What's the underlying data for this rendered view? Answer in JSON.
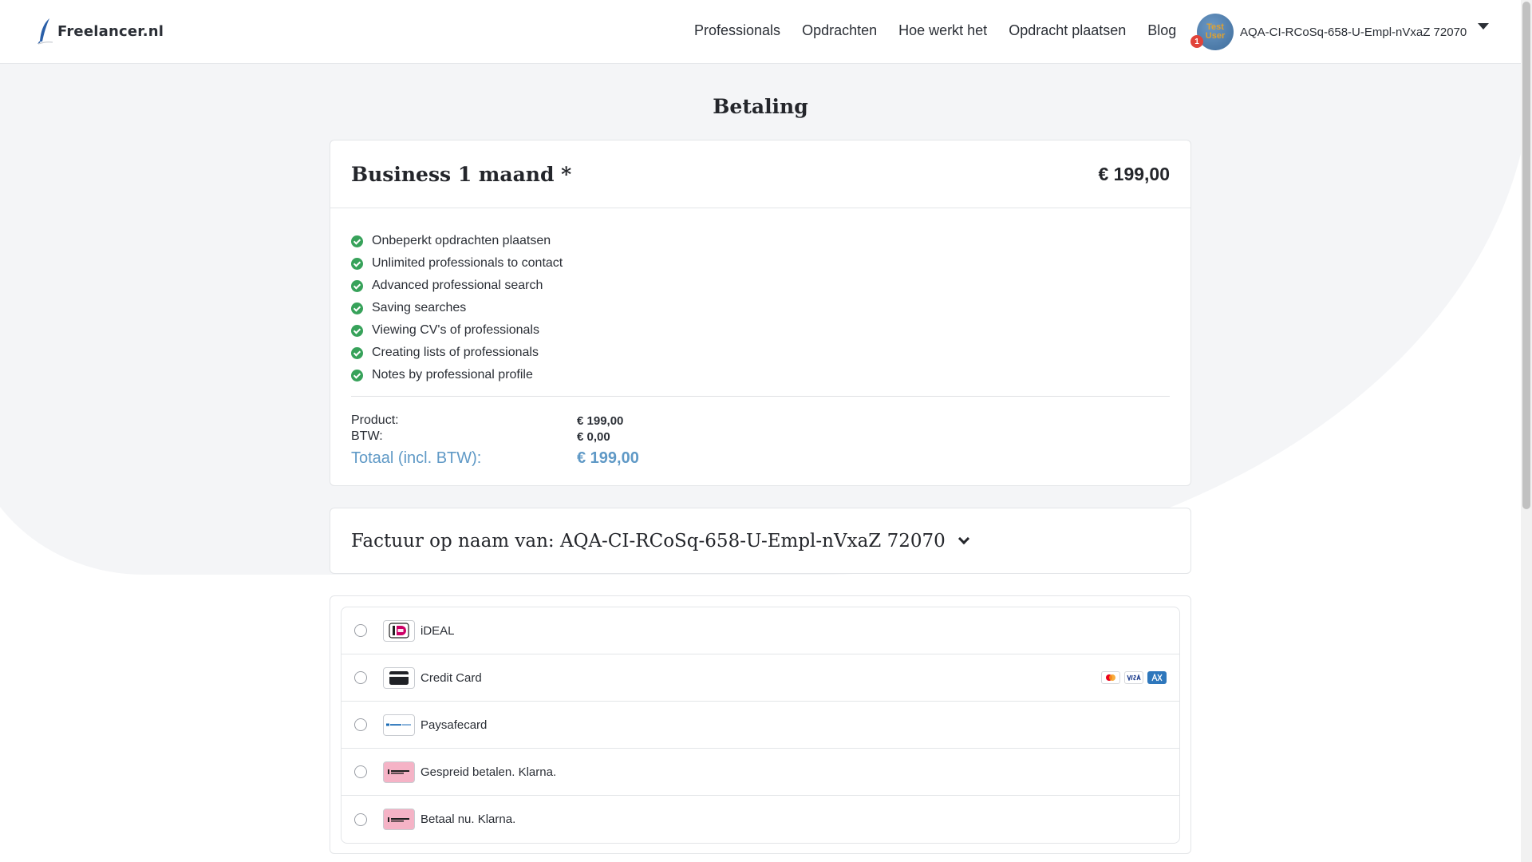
{
  "header": {
    "logo_text": "Freelancer.nl",
    "nav": [
      "Professionals",
      "Opdrachten",
      "Hoe werkt het",
      "Opdracht plaatsen",
      "Blog"
    ],
    "user": {
      "avatar_text": "Test User",
      "notification_count": "1",
      "name": "AQA-CI-RCoSq-658-U-Empl-nVxaZ 72070"
    }
  },
  "page": {
    "title": "Betaling"
  },
  "plan": {
    "name": "Business 1 maand *",
    "price": "€ 199,00",
    "features": [
      "Onbeperkt opdrachten plaatsen",
      "Unlimited professionals to contact",
      "Advanced professional search",
      "Saving searches",
      "Viewing CV's of professionals",
      "Creating lists of professionals",
      "Notes by professional profile"
    ],
    "summary": {
      "product_label": "Product:",
      "product_value": "€ 199,00",
      "btw_label": "BTW:",
      "btw_value": "€ 0,00",
      "total_label": "Totaal (incl. BTW):",
      "total_value": "€ 199,00"
    }
  },
  "invoice": {
    "text": "Factuur op naam van: AQA-CI-RCoSq-658-U-Empl-nVxaZ 72070"
  },
  "payment_methods": [
    {
      "label": "iDEAL",
      "icon": "ideal-icon"
    },
    {
      "label": "Credit Card",
      "icon": "credit-card-icon",
      "brands": [
        "mastercard-icon",
        "visa-icon",
        "amex-icon"
      ]
    },
    {
      "label": "Paysafecard",
      "icon": "paysafecard-icon"
    },
    {
      "label": "Gespreid betalen. Klarna.",
      "icon": "klarna-icon"
    },
    {
      "label": "Betaal nu. Klarna.",
      "icon": "klarna-icon"
    }
  ],
  "colors": {
    "check_green": "#37a25a",
    "total_blue": "#5f99c6",
    "klarna_pink": "#f5b3c6",
    "ideal_pink": "#cc0066"
  }
}
